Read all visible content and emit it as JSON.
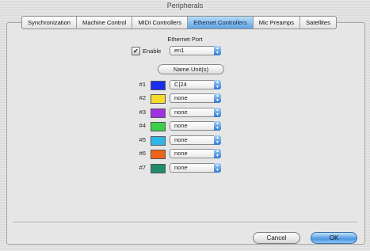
{
  "window": {
    "title": "Peripherals"
  },
  "tabs": [
    {
      "label": "Synchronization",
      "active": false
    },
    {
      "label": "Machine Control",
      "active": false
    },
    {
      "label": "MIDI Controllers",
      "active": false
    },
    {
      "label": "Ethernet Controllers",
      "active": true
    },
    {
      "label": "Mic Preamps",
      "active": false
    },
    {
      "label": "Satellites",
      "active": false
    }
  ],
  "ethernet": {
    "heading": "Ethernet Port",
    "enable_label": "Enable",
    "enable_checked": true,
    "port_value": "en1",
    "name_units_label": "Name Unit(s)"
  },
  "controllers": [
    {
      "num": "#1",
      "color": "#1a2cf0",
      "value": "C|24"
    },
    {
      "num": "#2",
      "color": "#f5dc2a",
      "value": "none"
    },
    {
      "num": "#3",
      "color": "#a030e0",
      "value": "none"
    },
    {
      "num": "#4",
      "color": "#3ccf4a",
      "value": "none"
    },
    {
      "num": "#5",
      "color": "#2fb6ea",
      "value": "none"
    },
    {
      "num": "#6",
      "color": "#ee6418",
      "value": "none"
    },
    {
      "num": "#7",
      "color": "#1f8a6c",
      "value": "none"
    }
  ],
  "buttons": {
    "cancel": "Cancel",
    "ok": "OK"
  }
}
